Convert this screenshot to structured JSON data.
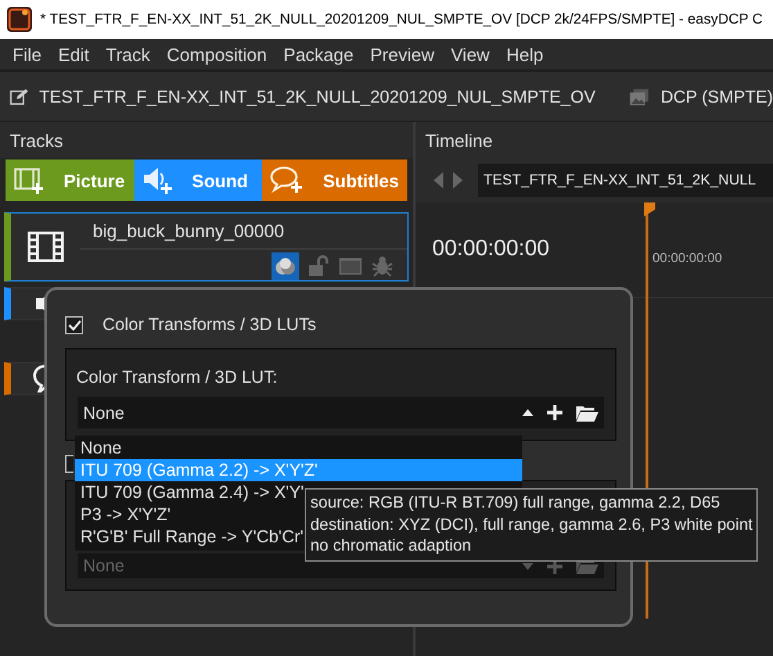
{
  "window": {
    "title": "* TEST_FTR_F_EN-XX_INT_51_2K_NULL_20201209_NUL_SMPTE_OV [DCP 2k/24FPS/SMPTE] - easyDCP C"
  },
  "menu": [
    "File",
    "Edit",
    "Track",
    "Composition",
    "Package",
    "Preview",
    "View",
    "Help"
  ],
  "composition_bar": {
    "name": "TEST_FTR_F_EN-XX_INT_51_2K_NULL_20201209_NUL_SMPTE_OV",
    "package_type": "DCP (SMPTE)"
  },
  "tracks_panel": {
    "title": "Tracks",
    "add_buttons": [
      {
        "kind": "picture",
        "label": "Picture",
        "color": "#6b9a1e"
      },
      {
        "kind": "sound",
        "label": "Sound",
        "color": "#1e8fff"
      },
      {
        "kind": "subtitle",
        "label": "Subtitles",
        "color": "#d96b00"
      }
    ],
    "tracks": [
      {
        "kind": "picture",
        "name": "big_buck_bunny_00000",
        "selected": true,
        "color": "#6b9a1e",
        "color_transform_active": true
      },
      {
        "kind": "sound",
        "selected": false,
        "color": "#1e8fff"
      },
      {
        "kind": "subtitle",
        "selected": false,
        "color": "#d96b00"
      }
    ]
  },
  "timeline_panel": {
    "title": "Timeline",
    "composition": "TEST_FTR_F_EN-XX_INT_51_2K_NULL",
    "timecode": "00:00:00:00",
    "ruler_time": "00:00:00:00"
  },
  "lut_popup": {
    "enable_checkbox": {
      "label": "Color Transforms / 3D LUTs",
      "checked": true
    },
    "lut_label": "Color Transform / 3D LUT:",
    "lut_combo": {
      "value": "None",
      "expanded": true
    },
    "second_checkbox": {
      "checked": false
    },
    "second_combo": {
      "value": "None",
      "disabled": true
    },
    "dropdown_items": [
      {
        "label": "None",
        "selected": false
      },
      {
        "label": "ITU 709 (Gamma 2.2) -> X'Y'Z'",
        "selected": true
      },
      {
        "label": "ITU 709 (Gamma 2.4) -> X'Y'",
        "selected": false
      },
      {
        "label": "P3 -> X'Y'Z'",
        "selected": false
      },
      {
        "label": "R'G'B' Full Range -> Y'Cb'Cr'",
        "selected": false
      }
    ],
    "tooltip": [
      "source: RGB (ITU-R BT.709) full range, gamma 2.2, D65",
      "destination: XYZ (DCI), full range, gamma 2.6, P3 white point",
      "no chromatic adaption"
    ]
  }
}
